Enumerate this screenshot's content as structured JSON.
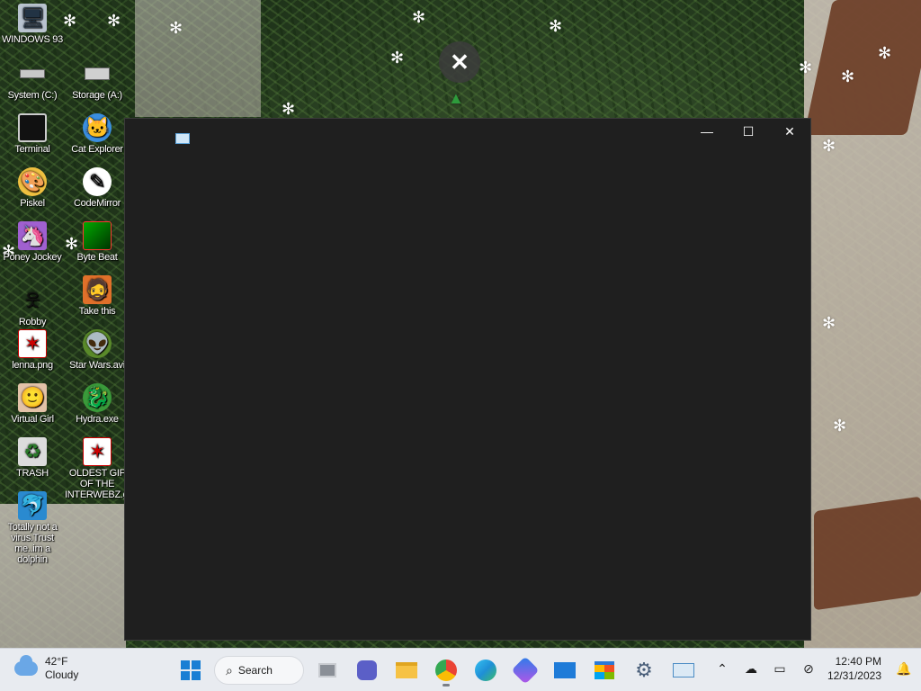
{
  "desktop": {
    "icons": [
      {
        "label": "WINDOWS 93",
        "icon": "computer-icon"
      },
      {
        "label": "System (C:)",
        "icon": "drive-icon"
      },
      {
        "label": "Storage (A:)",
        "icon": "floppy-icon"
      },
      {
        "label": "Terminal",
        "icon": "terminal-icon"
      },
      {
        "label": "Cat Explorer",
        "icon": "cat-globe-icon"
      },
      {
        "label": "Piskel",
        "icon": "palette-icon"
      },
      {
        "label": "CodeMirror",
        "icon": "codemirror-icon"
      },
      {
        "label": "Poney Jockey",
        "icon": "pony-icon"
      },
      {
        "label": "Byte Beat",
        "icon": "bytebeat-icon"
      },
      {
        "label": "Robby",
        "icon": "stick-figure-icon"
      },
      {
        "label": "Take this",
        "icon": "pixel-man-icon"
      },
      {
        "label": "lenna.png",
        "icon": "image-file-icon"
      },
      {
        "label": "Star Wars.avi",
        "icon": "yoda-icon"
      },
      {
        "label": "Virtual Girl",
        "icon": "face-icon"
      },
      {
        "label": "Hydra.exe",
        "icon": "hydra-icon"
      },
      {
        "label": "TRASH",
        "icon": "trash-icon"
      },
      {
        "label": "OLDEST GIF OF THE INTERWEBZ.gif",
        "icon": "gif-file-icon"
      },
      {
        "label": "Totally not a virus.Trust me..im a dolphin",
        "icon": "dolphin-shortcut-icon"
      }
    ]
  },
  "overlay": {
    "close_glyph": "✕"
  },
  "window": {
    "minimize_glyph": "—",
    "maximize_glyph": "☐",
    "close_glyph": "✕"
  },
  "taskbar": {
    "weather": {
      "temp": "42°F",
      "condition": "Cloudy"
    },
    "search_label": "Search",
    "clock": {
      "time": "12:40 PM",
      "date": "12/31/2023"
    },
    "pinned": [
      "start-icon",
      "task-view-icon",
      "meet-icon",
      "file-explorer-icon",
      "chrome-icon",
      "edge-icon",
      "copilot-icon",
      "mail-icon",
      "store-icon",
      "settings-icon",
      "monitor-app-icon"
    ]
  }
}
